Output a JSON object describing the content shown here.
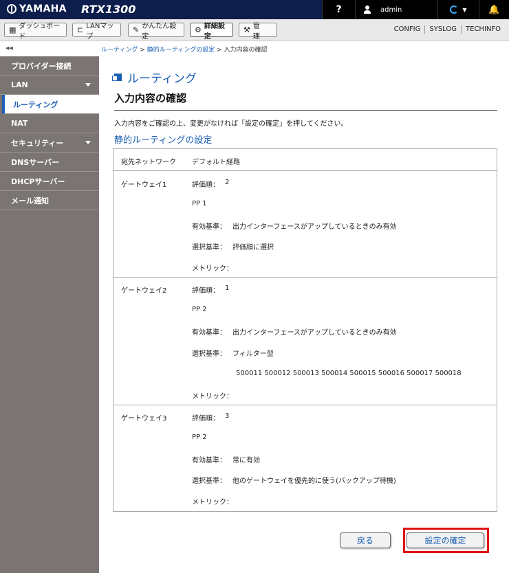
{
  "header": {
    "brand": "YAMAHA",
    "model": "RTX1300",
    "help": "?",
    "user": "admin"
  },
  "nav": {
    "dashboard": "ダッシュボード",
    "lanmap": "LANマップ",
    "easy": "かんたん設定",
    "detail": "詳細設定",
    "manage": "管　理",
    "links": [
      "CONFIG",
      "SYSLOG",
      "TECHINFO"
    ]
  },
  "breadcrumb": {
    "collapse": "◀◀",
    "items": [
      "ルーティング",
      "静的ルーティングの設定",
      "入力内容の確認"
    ]
  },
  "sidebar": {
    "items": [
      {
        "label": "プロバイダー接続"
      },
      {
        "label": "LAN"
      },
      {
        "label": "ルーティング"
      },
      {
        "label": "NAT"
      },
      {
        "label": "セキュリティー"
      },
      {
        "label": "DNSサーバー"
      },
      {
        "label": "DHCPサーバー"
      },
      {
        "label": "メール通知"
      }
    ]
  },
  "main": {
    "page_title": "ルーティング",
    "section_title": "入力内容の確認",
    "instruction": "入力内容をご確認の上、変更がなければ「設定の確定」を押してください。",
    "subsection": "静的ルーティングの設定",
    "dest_label": "宛先ネットワーク",
    "dest_value": "デフォルト経路",
    "labels": {
      "priority": "評価順：",
      "condition": "有効基準：",
      "select": "選択基準：",
      "metric": "メトリック："
    },
    "gateways": [
      {
        "name": "ゲートウェイ1",
        "priority": "2",
        "interface": "PP 1",
        "condition": "出力インターフェースがアップしているときのみ有効",
        "select": "評価順に選択",
        "filters": "",
        "metric": ""
      },
      {
        "name": "ゲートウェイ2",
        "priority": "1",
        "interface": "PP 2",
        "condition": "出力インターフェースがアップしているときのみ有効",
        "select": "フィルター型",
        "filters": "500011 500012 500013 500014 500015 500016 500017 500018",
        "metric": ""
      },
      {
        "name": "ゲートウェイ3",
        "priority": "3",
        "interface": "PP 2",
        "condition": "常に有効",
        "select": "他のゲートウェイを優先的に使う(バックアップ待機)",
        "filters": "",
        "metric": ""
      }
    ]
  },
  "buttons": {
    "back": "戻る",
    "confirm": "設定の確定"
  }
}
